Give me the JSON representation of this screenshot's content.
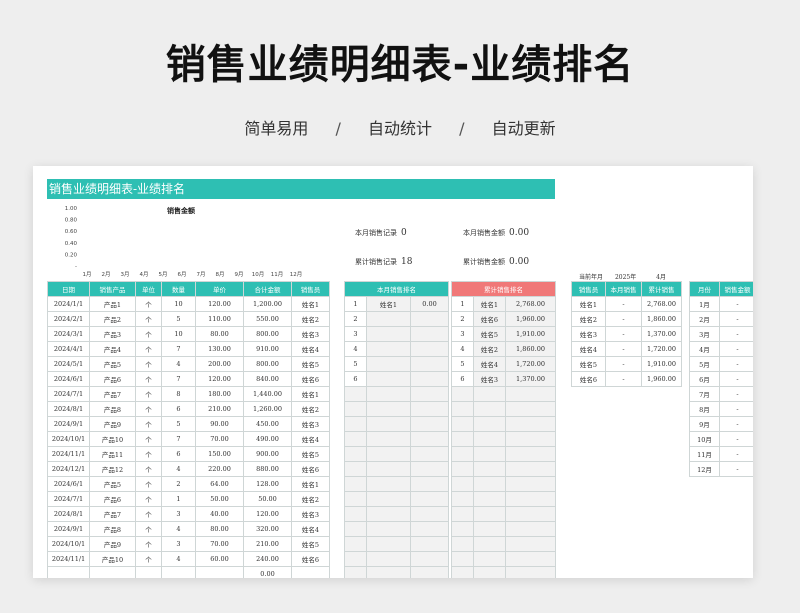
{
  "page": {
    "title": "销售业绩明细表-业绩排名",
    "tags": [
      "简单易用",
      "自动统计",
      "自动更新"
    ],
    "separator": "/"
  },
  "sheet": {
    "banner": "销售业绩明细表-业绩排名",
    "month_stats": {
      "count_label": "本月销售记录",
      "count_value": "0",
      "amount_label": "本月销售金额",
      "amount_value": "0.00"
    },
    "total_stats": {
      "count_label": "累计销售记录",
      "count_value": "18",
      "amount_label": "累计销售金额",
      "amount_value": "0.00"
    },
    "current": {
      "label": "当前年月",
      "year": "2025年",
      "month": "4月"
    }
  },
  "chart_data": {
    "type": "bar",
    "title": "销售金额",
    "categories": [
      "1月",
      "2月",
      "3月",
      "4月",
      "5月",
      "6月",
      "7月",
      "8月",
      "9月",
      "10月",
      "11月",
      "12月"
    ],
    "values": [
      0,
      0,
      0,
      0,
      0,
      0,
      0,
      0,
      0,
      0,
      0,
      0
    ],
    "y_ticks": [
      "1.00",
      "0.80",
      "0.60",
      "0.40",
      "0.20",
      "-"
    ],
    "ylim": [
      0,
      1
    ]
  },
  "detail": {
    "headers": [
      "日期",
      "销售产品",
      "单位",
      "数量",
      "单价",
      "合计金额",
      "销售员"
    ],
    "rows": [
      [
        "2024/1/1",
        "产品1",
        "个",
        "10",
        "120.00",
        "1,200.00",
        "姓名1"
      ],
      [
        "2024/2/1",
        "产品2",
        "个",
        "5",
        "110.00",
        "550.00",
        "姓名2"
      ],
      [
        "2024/3/1",
        "产品3",
        "个",
        "10",
        "80.00",
        "800.00",
        "姓名3"
      ],
      [
        "2024/4/1",
        "产品4",
        "个",
        "7",
        "130.00",
        "910.00",
        "姓名4"
      ],
      [
        "2024/5/1",
        "产品5",
        "个",
        "4",
        "200.00",
        "800.00",
        "姓名5"
      ],
      [
        "2024/6/1",
        "产品6",
        "个",
        "7",
        "120.00",
        "840.00",
        "姓名6"
      ],
      [
        "2024/7/1",
        "产品7",
        "个",
        "8",
        "180.00",
        "1,440.00",
        "姓名1"
      ],
      [
        "2024/8/1",
        "产品8",
        "个",
        "6",
        "210.00",
        "1,260.00",
        "姓名2"
      ],
      [
        "2024/9/1",
        "产品9",
        "个",
        "5",
        "90.00",
        "450.00",
        "姓名3"
      ],
      [
        "2024/10/1",
        "产品10",
        "个",
        "7",
        "70.00",
        "490.00",
        "姓名4"
      ],
      [
        "2024/11/1",
        "产品11",
        "个",
        "6",
        "150.00",
        "900.00",
        "姓名5"
      ],
      [
        "2024/12/1",
        "产品12",
        "个",
        "4",
        "220.00",
        "880.00",
        "姓名6"
      ],
      [
        "2024/6/1",
        "产品5",
        "个",
        "2",
        "64.00",
        "128.00",
        "姓名1"
      ],
      [
        "2024/7/1",
        "产品6",
        "个",
        "1",
        "50.00",
        "50.00",
        "姓名2"
      ],
      [
        "2024/8/1",
        "产品7",
        "个",
        "3",
        "40.00",
        "120.00",
        "姓名3"
      ],
      [
        "2024/9/1",
        "产品8",
        "个",
        "4",
        "80.00",
        "320.00",
        "姓名4"
      ],
      [
        "2024/10/1",
        "产品9",
        "个",
        "3",
        "70.00",
        "210.00",
        "姓名5"
      ],
      [
        "2024/11/1",
        "产品10",
        "个",
        "4",
        "60.00",
        "240.00",
        "姓名6"
      ]
    ],
    "partial_total": "0.00"
  },
  "month_rank": {
    "header": "本月销售排名",
    "rows": [
      [
        "1",
        "姓名1",
        "0.00"
      ],
      [
        "2",
        "",
        ""
      ],
      [
        "3",
        "",
        ""
      ],
      [
        "4",
        "",
        ""
      ],
      [
        "5",
        "",
        ""
      ],
      [
        "6",
        "",
        ""
      ]
    ]
  },
  "total_rank": {
    "header": "累计销售排名",
    "rows": [
      [
        "1",
        "姓名1",
        "2,768.00"
      ],
      [
        "2",
        "姓名6",
        "1,960.00"
      ],
      [
        "3",
        "姓名5",
        "1,910.00"
      ],
      [
        "4",
        "姓名2",
        "1,860.00"
      ],
      [
        "5",
        "姓名4",
        "1,720.00"
      ],
      [
        "6",
        "姓名3",
        "1,370.00"
      ]
    ]
  },
  "staff": {
    "headers": [
      "销售员",
      "本月销售",
      "累计销售"
    ],
    "rows": [
      [
        "姓名1",
        "-",
        "2,768.00"
      ],
      [
        "姓名2",
        "-",
        "1,860.00"
      ],
      [
        "姓名3",
        "-",
        "1,370.00"
      ],
      [
        "姓名4",
        "-",
        "1,720.00"
      ],
      [
        "姓名5",
        "-",
        "1,910.00"
      ],
      [
        "姓名6",
        "-",
        "1,960.00"
      ]
    ]
  },
  "monthly": {
    "headers": [
      "月份",
      "销售金额"
    ],
    "rows": [
      [
        "1月",
        "-"
      ],
      [
        "2月",
        "-"
      ],
      [
        "3月",
        "-"
      ],
      [
        "4月",
        "-"
      ],
      [
        "5月",
        "-"
      ],
      [
        "6月",
        "-"
      ],
      [
        "7月",
        "-"
      ],
      [
        "8月",
        "-"
      ],
      [
        "9月",
        "-"
      ],
      [
        "10月",
        "-"
      ],
      [
        "11月",
        "-"
      ],
      [
        "12月",
        "-"
      ]
    ]
  }
}
